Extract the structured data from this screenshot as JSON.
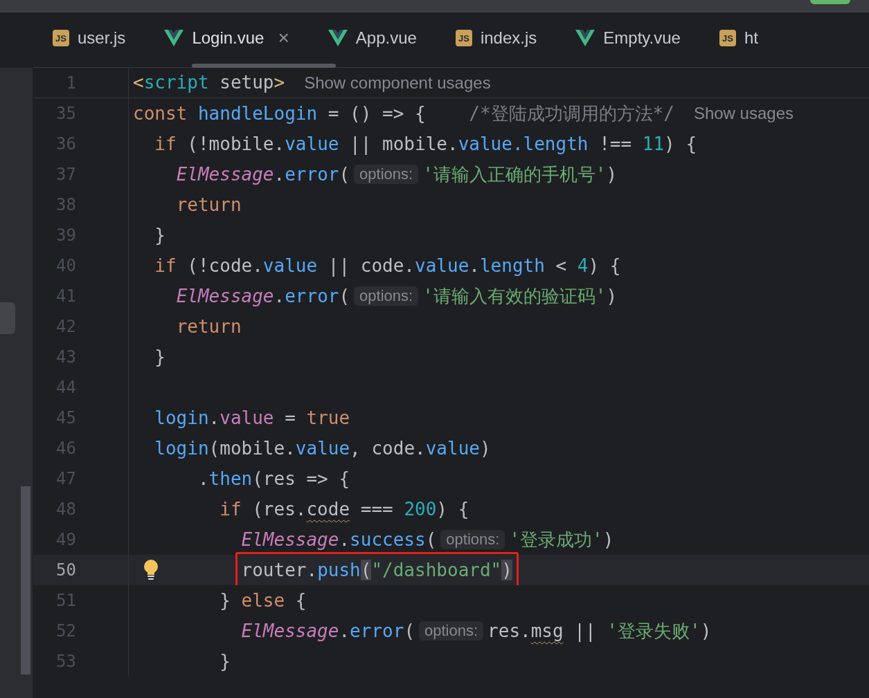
{
  "tabs": [
    {
      "label": "user.js",
      "kind": "js",
      "icon_label": "JS",
      "selected": false
    },
    {
      "label": "Login.vue",
      "kind": "vue",
      "selected": true,
      "close": "×"
    },
    {
      "label": "App.vue",
      "kind": "vue",
      "selected": false
    },
    {
      "label": "index.js",
      "kind": "js",
      "icon_label": "JS",
      "selected": false
    },
    {
      "label": "Empty.vue",
      "kind": "vue",
      "selected": false
    },
    {
      "label": "ht",
      "kind": "js",
      "icon_label": "JS",
      "selected": false
    }
  ],
  "sticky_line": {
    "number": "1",
    "tokens": [
      {
        "kind": "tag",
        "text": "<"
      },
      {
        "kind": "tagname",
        "text": "script"
      },
      {
        "kind": "plain",
        "text": " setup"
      },
      {
        "kind": "tag",
        "text": ">"
      },
      {
        "kind": "hint",
        "text": "Show component usages"
      }
    ]
  },
  "lines": [
    {
      "number": "35",
      "current": false,
      "tokens": [
        {
          "kind": "kw",
          "text": "const"
        },
        {
          "kind": "fn",
          "text": " handleLogin"
        },
        {
          "kind": "plain",
          "text": " = () => {    "
        },
        {
          "kind": "cmt",
          "text": "/*登陆成功调用的方法*/"
        },
        {
          "kind": "hint",
          "text": "Show usages"
        }
      ]
    },
    {
      "number": "36",
      "current": false,
      "tokens": [
        {
          "kind": "kw",
          "text": "  if"
        },
        {
          "kind": "plain",
          "text": " (!mobile."
        },
        {
          "kind": "fn",
          "text": "value"
        },
        {
          "kind": "plain",
          "text": " || mobile."
        },
        {
          "kind": "fn",
          "text": "value.length"
        },
        {
          "kind": "plain",
          "text": " !== "
        },
        {
          "kind": "num",
          "text": "11"
        },
        {
          "kind": "plain",
          "text": ") {"
        }
      ]
    },
    {
      "number": "37",
      "current": false,
      "tokens": [
        {
          "kind": "cls",
          "text": "    ElMessage"
        },
        {
          "kind": "plain",
          "text": "."
        },
        {
          "kind": "fn",
          "text": "error"
        },
        {
          "kind": "plain",
          "text": "("
        },
        {
          "kind": "inlay",
          "text": "options:"
        },
        {
          "kind": "str",
          "text": "'请输入正确的手机号'"
        },
        {
          "kind": "plain",
          "text": ")"
        }
      ]
    },
    {
      "number": "38",
      "current": false,
      "tokens": [
        {
          "kind": "kw",
          "text": "    return"
        }
      ]
    },
    {
      "number": "39",
      "current": false,
      "tokens": [
        {
          "kind": "plain",
          "text": "  }"
        }
      ]
    },
    {
      "number": "40",
      "current": false,
      "tokens": [
        {
          "kind": "kw",
          "text": "  if"
        },
        {
          "kind": "plain",
          "text": " (!code."
        },
        {
          "kind": "fn",
          "text": "value"
        },
        {
          "kind": "plain",
          "text": " || code."
        },
        {
          "kind": "fn",
          "text": "value"
        },
        {
          "kind": "plain",
          "text": "."
        },
        {
          "kind": "fn",
          "text": "length"
        },
        {
          "kind": "plain",
          "text": " < "
        },
        {
          "kind": "num",
          "text": "4"
        },
        {
          "kind": "plain",
          "text": ") {"
        }
      ]
    },
    {
      "number": "41",
      "current": false,
      "tokens": [
        {
          "kind": "cls",
          "text": "    ElMessage"
        },
        {
          "kind": "plain",
          "text": "."
        },
        {
          "kind": "fn",
          "text": "error"
        },
        {
          "kind": "plain",
          "text": "("
        },
        {
          "kind": "inlay",
          "text": "options:"
        },
        {
          "kind": "str",
          "text": "'请输入有效的验证码'"
        },
        {
          "kind": "plain",
          "text": ")"
        }
      ]
    },
    {
      "number": "42",
      "current": false,
      "tokens": [
        {
          "kind": "kw",
          "text": "    return"
        }
      ]
    },
    {
      "number": "43",
      "current": false,
      "tokens": [
        {
          "kind": "plain",
          "text": "  }"
        }
      ]
    },
    {
      "number": "44",
      "current": false
    },
    {
      "number": "45",
      "current": false,
      "tokens": [
        {
          "kind": "fn",
          "text": "  login"
        },
        {
          "kind": "plain",
          "text": "."
        },
        {
          "kind": "mem",
          "text": "value"
        },
        {
          "kind": "plain",
          "text": " = "
        },
        {
          "kind": "kw",
          "text": "true"
        }
      ]
    },
    {
      "number": "46",
      "current": false,
      "tokens": [
        {
          "kind": "fn",
          "text": "  login"
        },
        {
          "kind": "plain",
          "text": "(mobile."
        },
        {
          "kind": "fn",
          "text": "value"
        },
        {
          "kind": "plain",
          "text": ", code."
        },
        {
          "kind": "fn",
          "text": "value"
        },
        {
          "kind": "plain",
          "text": ")"
        }
      ]
    },
    {
      "number": "47",
      "current": false,
      "tokens": [
        {
          "kind": "plain",
          "text": "      ."
        },
        {
          "kind": "fn",
          "text": "then"
        },
        {
          "kind": "plain",
          "text": "(res => {"
        }
      ]
    },
    {
      "number": "48",
      "current": false,
      "tokens": [
        {
          "kind": "kw",
          "text": "        if"
        },
        {
          "kind": "plain",
          "text": " (res."
        },
        {
          "kind": "plain",
          "text": "code",
          "warning": true
        },
        {
          "kind": "plain",
          "text": " === "
        },
        {
          "kind": "num",
          "text": "200"
        },
        {
          "kind": "plain",
          "text": ") {"
        }
      ]
    },
    {
      "number": "49",
      "current": false,
      "tokens": [
        {
          "kind": "cls",
          "text": "          ElMessage"
        },
        {
          "kind": "plain",
          "text": "."
        },
        {
          "kind": "fn",
          "text": "success"
        },
        {
          "kind": "plain",
          "text": "("
        },
        {
          "kind": "inlay",
          "text": "options:"
        },
        {
          "kind": "str",
          "text": "'登录成功'"
        },
        {
          "kind": "plain",
          "text": ")"
        }
      ]
    },
    {
      "number": "50",
      "current": true,
      "bulb": true,
      "boxed": true,
      "tokens": [
        {
          "kind": "plain",
          "text": "          router."
        },
        {
          "kind": "fn",
          "text": "push"
        },
        {
          "kind": "plain",
          "text": "(",
          "matched": true
        },
        {
          "kind": "str",
          "text": "\"/dashboard\""
        },
        {
          "kind": "plain",
          "text": ")",
          "matched": true
        }
      ]
    },
    {
      "number": "51",
      "current": false,
      "tokens": [
        {
          "kind": "plain",
          "text": "        } "
        },
        {
          "kind": "kw",
          "text": "else"
        },
        {
          "kind": "plain",
          "text": " {"
        }
      ]
    },
    {
      "number": "52",
      "current": false,
      "tokens": [
        {
          "kind": "cls",
          "text": "          ElMessage"
        },
        {
          "kind": "plain",
          "text": "."
        },
        {
          "kind": "fn",
          "text": "error"
        },
        {
          "kind": "plain",
          "text": "("
        },
        {
          "kind": "inlay",
          "text": "options:"
        },
        {
          "kind": "plain",
          "text": "res."
        },
        {
          "kind": "plain",
          "text": "msg",
          "warning": true
        },
        {
          "kind": "plain",
          "text": " || "
        },
        {
          "kind": "str",
          "text": "'登录失败'"
        },
        {
          "kind": "plain",
          "text": ")"
        }
      ]
    },
    {
      "number": "53",
      "current": false,
      "tokens": [
        {
          "kind": "plain",
          "text": "        }"
        }
      ]
    }
  ]
}
